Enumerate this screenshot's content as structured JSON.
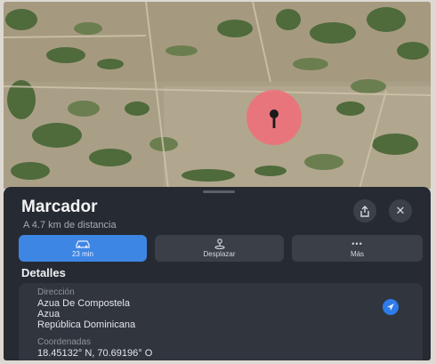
{
  "sheet": {
    "title": "Marcador",
    "subtitle": "A 4.7 km de distancia",
    "share_icon": "share-icon",
    "close_icon": "close-icon",
    "close_glyph": "✕"
  },
  "actions": [
    {
      "label": "23 min",
      "icon": "car-icon"
    },
    {
      "label": "Desplazar",
      "icon": "look-around-icon"
    },
    {
      "label": "Más",
      "icon": "more-icon",
      "glyph": "•••"
    }
  ],
  "details": {
    "heading": "Detalles",
    "address_label": "Dirección",
    "address_lines": [
      "Azua De Compostela",
      "Azua",
      "República Dominicana"
    ],
    "coords_label": "Coordenadas",
    "coords_value": "18.45132° N, 70.69196° O",
    "location_icon": "location-arrow-icon"
  },
  "colors": {
    "sheet_bg": "#262b33",
    "primary_button": "#3e86e4",
    "pin": "#f0707a"
  }
}
